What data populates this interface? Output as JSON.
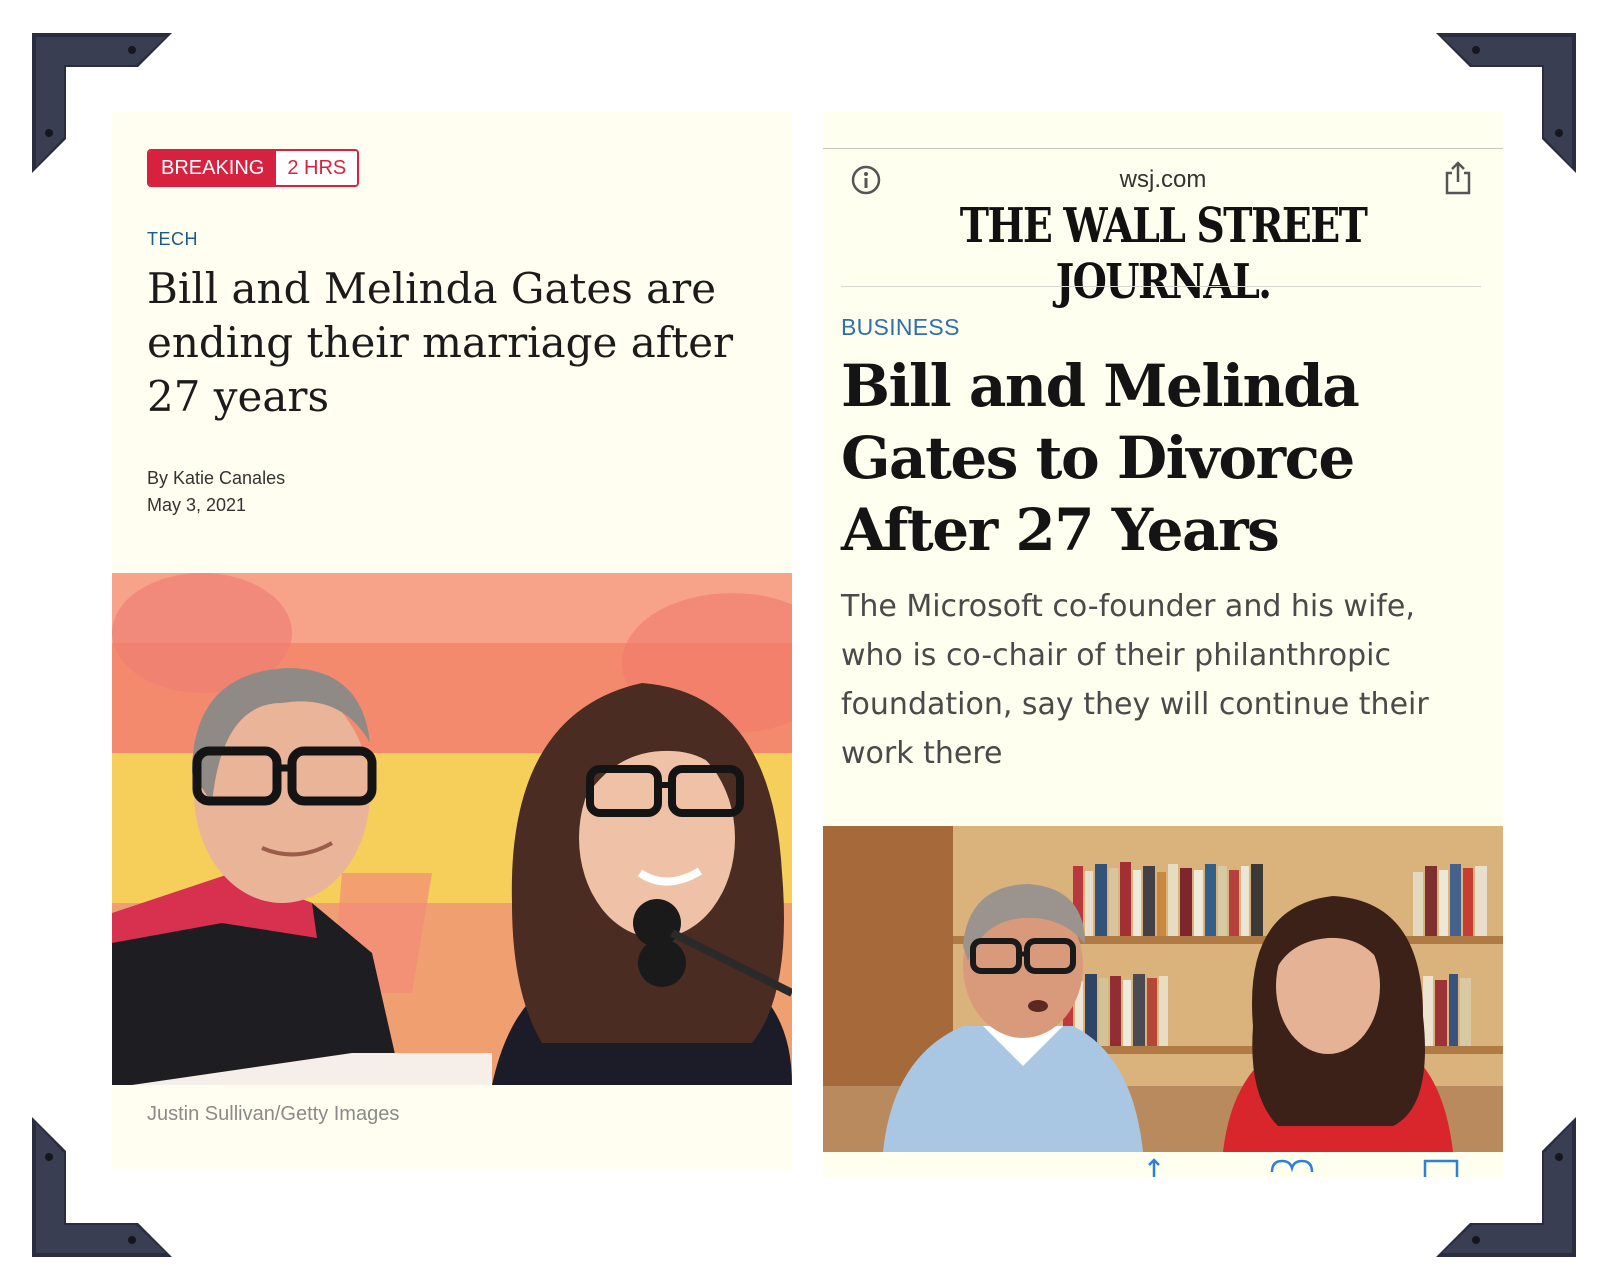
{
  "left_article": {
    "badge": {
      "label": "BREAKING",
      "time": "2 HRS"
    },
    "section": "TECH",
    "headline": "Bill and Melinda Gates are ending their marriage after 27 years",
    "byline": "By Katie Canales",
    "date": "May 3, 2021",
    "photo_credit": "Justin Sullivan/Getty Images"
  },
  "right_article": {
    "url": "wsj.com",
    "masthead": "THE WALL STREET JOURNAL.",
    "section": "BUSINESS",
    "headline": "Bill and Melinda Gates to Divorce After 27 Years",
    "dek": "The Microsoft co-founder and his wife, who is co-chair of their philanthropic foundation, say they will continue their work there"
  },
  "icons": {
    "info": "info-icon",
    "share": "share-icon",
    "toolbar_share": "share-icon",
    "toolbar_bookmarks": "bookmarks-icon",
    "toolbar_tabs": "tabs-icon"
  },
  "colors": {
    "breaking_red": "#d6223e",
    "section_blue": "#2f6fab",
    "tech_blue": "#1a5c8a",
    "panel_bg": "#fffef0",
    "corner_dark": "#2a2d3e"
  }
}
